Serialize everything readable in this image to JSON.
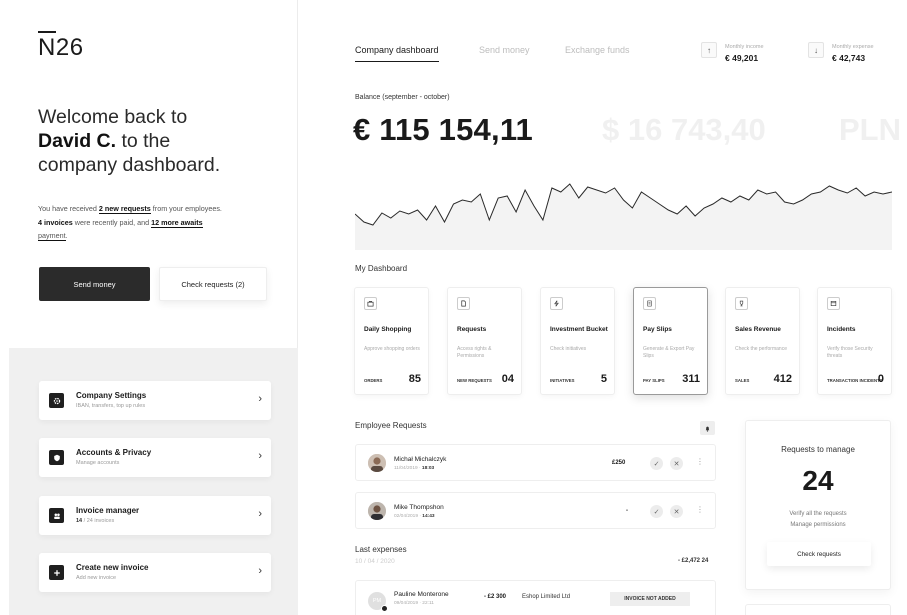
{
  "brand": {
    "logo_first": "N",
    "logo_rest": "26"
  },
  "welcome": {
    "line1": "Welcome back to",
    "name": "David C.",
    "line2_rest": " to the",
    "line3": "company dashboard."
  },
  "summary": {
    "p1": "You have received ",
    "b1": "2 new requests",
    "p2": " from your employees.",
    "b2": "4 invoices",
    "p3": " were recently paid, and ",
    "b3": "12 more awaits",
    "p4": "payment",
    "p5": "."
  },
  "actions": {
    "send_money": "Send money",
    "check_requests": "Check requests (2)"
  },
  "settings": [
    {
      "title": "Company Settings",
      "sub": "IBAN, transfers, top up rules"
    },
    {
      "title": "Accounts & Privacy",
      "sub": "Manage accounts"
    },
    {
      "title": "Invoice manager",
      "sub_bold": "14",
      "sub": " / 24 invoices"
    },
    {
      "title": "Create new invoice",
      "sub": "Add new invoice"
    }
  ],
  "tabs": [
    "Company dashboard",
    "Send money",
    "Exchange funds"
  ],
  "stats": {
    "income": {
      "label": "Monthly income",
      "value": "€ 49,201",
      "icon": "arrow-up-icon"
    },
    "expense": {
      "label": "Monthly expense",
      "value": "€ 42,743",
      "icon": "arrow-down-icon"
    }
  },
  "balance": {
    "label": "Balance (september - october)",
    "eur": "€ 115 154,11",
    "usd": "$ 16 743,40",
    "pln": "PLN"
  },
  "colors": {
    "dark": "#2b2b2b",
    "accent": "#1a1a1a",
    "panel": "#f0f0f0",
    "chart_fill": "#f3f3f3"
  },
  "chart_data": {
    "type": "area",
    "title": "",
    "xlabel": "",
    "ylabel": "",
    "x_ticks": [],
    "y_ticks": [],
    "values": [
      36,
      28,
      25,
      37,
      32,
      39,
      36,
      40,
      30,
      44,
      28,
      46,
      50,
      48,
      56,
      30,
      52,
      54,
      38,
      60,
      44,
      30,
      62,
      58,
      66,
      52,
      63,
      60,
      57,
      62,
      50,
      42,
      58,
      52,
      46,
      40,
      36,
      44,
      34,
      42,
      46,
      52,
      48,
      54,
      50,
      60,
      56,
      58,
      48,
      46,
      50,
      56,
      58,
      64,
      60,
      57,
      62,
      54,
      58,
      56,
      58
    ],
    "ylim": [
      0,
      80
    ]
  },
  "dashboard": {
    "title": "My Dashboard",
    "cards": [
      {
        "title": "Daily Shopping",
        "desc": "Approve shopping orders",
        "foot": "ORDERS",
        "num": "85",
        "icon": "bag-icon"
      },
      {
        "title": "Requests",
        "desc": "Access rights & Permissions",
        "foot": "NEW REQUESTS",
        "num": "04",
        "icon": "document-icon"
      },
      {
        "title": "Investment Bucket",
        "desc": "Check initiatives",
        "foot": "INITIATIVES",
        "num": "5",
        "icon": "bolt-icon"
      },
      {
        "title": "Pay Slips",
        "desc": "Generate & Export Pay Slips",
        "foot": "PAY SLIPS",
        "num": "311",
        "icon": "receipt-icon"
      },
      {
        "title": "Sales Revenue",
        "desc": "Check the performance",
        "foot": "SALES",
        "num": "412",
        "icon": "trophy-icon"
      },
      {
        "title": "Incidents",
        "desc": "Verify those Security threats",
        "foot": "TRANSACTION INCIDENTS",
        "num": "0",
        "icon": "alert-icon"
      }
    ]
  },
  "employee_requests": {
    "title": "Employee Requests",
    "rows": [
      {
        "name": "Michał Michalczyk",
        "date": "11/04/2019 · ",
        "time": "18:03",
        "amount": "£250"
      },
      {
        "name": "Mike Thompshon",
        "date": "02/04/2019 · ",
        "time": "14:43",
        "amount": "-"
      }
    ]
  },
  "expenses": {
    "title": "Last expenses",
    "date": "10 / 04 / 2020",
    "total": "- £2,472 24",
    "rows": [
      {
        "initials": "PM",
        "name": "Pauline Monterone",
        "sub": "09/04/2019 · 22:11",
        "amount": "- £2 300",
        "shop": "Eshop Limited Ltd",
        "badge": "INVOICE NOT ADDED"
      }
    ]
  },
  "manage": {
    "title": "Requests to manage",
    "count": "24",
    "line1": "Verify all the requests",
    "line2": "Manage permissions",
    "button": "Check requests"
  }
}
